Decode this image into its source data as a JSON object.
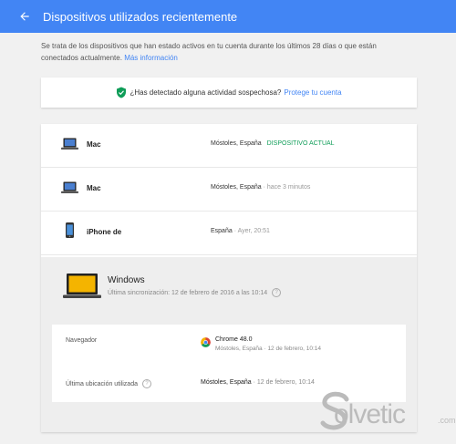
{
  "header": {
    "title": "Dispositivos utilizados recientemente",
    "back_icon": "arrow-back-icon",
    "color": "#4285f4"
  },
  "intro": {
    "text": "Se trata de los dispositivos que han estado activos en tu cuenta durante los últimos 28 días o que están conectados actualmente.",
    "link": "Más información"
  },
  "alert": {
    "icon": "shield-check-icon",
    "question": "¿Has detectado alguna actividad sospechosa?",
    "link": "Protege tu cuenta"
  },
  "devices": [
    {
      "name": "Mac",
      "icon": "laptop-icon",
      "location": "Móstoles, España",
      "time": "",
      "status": "DISPOSITIVO ACTUAL"
    },
    {
      "name": "Mac",
      "icon": "laptop-icon",
      "location": "Móstoles, España",
      "time": "· hace 3 minutos",
      "status": ""
    },
    {
      "name": "iPhone de",
      "icon": "phone-icon",
      "location": "España",
      "time": "· Ayer, 20:51",
      "status": ""
    }
  ],
  "expanded_device": {
    "name": "Windows",
    "icon": "laptop-icon",
    "sync": "Última sincronización: 12 de febrero de 2016 a las 10:14",
    "browser_label": "Navegador",
    "browser_name": "Chrome 48.0",
    "browser_sub": "Móstoles, España · 12 de febrero, 10:14",
    "location_label": "Última ubicación utilizada",
    "location_value": "Móstoles, España",
    "location_time": "· 12 de febrero, 10:14"
  },
  "watermark": {
    "text": "olvetic",
    "suffix": ".com"
  }
}
